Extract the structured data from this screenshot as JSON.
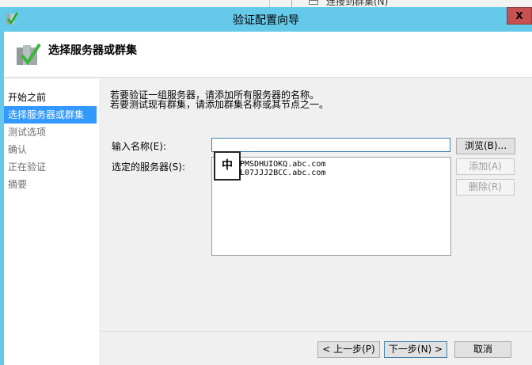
{
  "background_window": {
    "menu_item": "连接到群集(N)"
  },
  "window": {
    "title": "验证配置向导",
    "close_label": "X"
  },
  "header": {
    "title": "选择服务器或群集"
  },
  "nav": {
    "items": [
      {
        "label": "开始之前",
        "state": "normal"
      },
      {
        "label": "选择服务器或群集",
        "state": "selected"
      },
      {
        "label": "测试选项",
        "state": "disabled"
      },
      {
        "label": "确认",
        "state": "disabled"
      },
      {
        "label": "正在验证",
        "state": "disabled"
      },
      {
        "label": "摘要",
        "state": "disabled"
      }
    ]
  },
  "main": {
    "description_line1": "若要验证一组服务器，请添加所有服务器的名称。",
    "description_line2": "若要测试现有群集，请添加群集名称或其节点之一。",
    "name_label": "输入名称(E):",
    "name_value": "",
    "selected_label": "选定的服务器(S):",
    "servers": [
      "PMSDHUIOKQ.abc.com",
      "L07JJJ2BCC.abc.com"
    ],
    "browse_label": "浏览(B)...",
    "add_label": "添加(A)",
    "remove_label": "删除(R)",
    "ime_indicator": "中"
  },
  "footer": {
    "back_label": "< 上一步(P)",
    "next_label": "下一步(N) >",
    "cancel_label": "取消"
  }
}
